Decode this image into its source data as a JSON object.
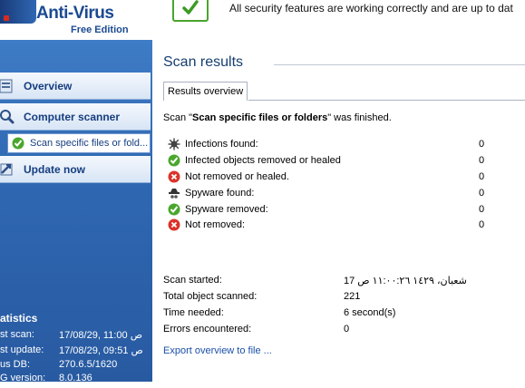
{
  "header": {
    "brand_name": "Anti-Virus",
    "brand_edition": "Free Edition",
    "status_text": "All security features are working correctly and are up to dat"
  },
  "sidebar": {
    "items": [
      {
        "label": "Overview",
        "icon": "overview-icon"
      },
      {
        "label": "Computer scanner",
        "icon": "magnifier-icon"
      },
      {
        "label": "Scan specific files or fold...",
        "icon": "check-icon"
      },
      {
        "label": "Update now",
        "icon": "update-icon"
      }
    ],
    "stats_title": "atistics",
    "stats": [
      {
        "key": "st scan:",
        "value": "17/08/29, 11:00 ص"
      },
      {
        "key": "st update:",
        "value": "17/08/29, 09:51 ص"
      },
      {
        "key": "us DB:",
        "value": "270.6.5/1620"
      },
      {
        "key": "G version:",
        "value": "8.0.136"
      }
    ]
  },
  "main": {
    "title": "Scan results",
    "tab_label": "Results overview",
    "summary": {
      "prefix": "Scan \"",
      "name": "Scan specific files or folders",
      "suffix": "\" was finished."
    },
    "results": [
      {
        "label": "Infections found:",
        "value": "0",
        "icon": "virus-icon"
      },
      {
        "label": "Infected objects removed or healed",
        "value": "0",
        "icon": "check-icon"
      },
      {
        "label": "Not removed or healed.",
        "value": "0",
        "icon": "error-icon"
      },
      {
        "label": "Spyware found:",
        "value": "0",
        "icon": "spyware-icon"
      },
      {
        "label": "Spyware removed:",
        "value": "0",
        "icon": "check-icon"
      },
      {
        "label": "Not removed:",
        "value": "0",
        "icon": "error-icon"
      }
    ],
    "info": [
      {
        "key": "Scan started:",
        "value": "شعبان، ١٤٢٩ ١١:٠٠:٢٦ ص 17"
      },
      {
        "key": "Total object scanned:",
        "value": "221"
      },
      {
        "key": "Time needed:",
        "value": "6 second(s)"
      },
      {
        "key": "Errors encountered:",
        "value": "0"
      }
    ],
    "export_link": "Export overview to file ..."
  },
  "colors": {
    "sidebar_blue": "#2f68b2",
    "nav_text": "#163e80",
    "link": "#1a4fa8",
    "ok_green": "#4aa42d",
    "error_red": "#d9342b"
  }
}
